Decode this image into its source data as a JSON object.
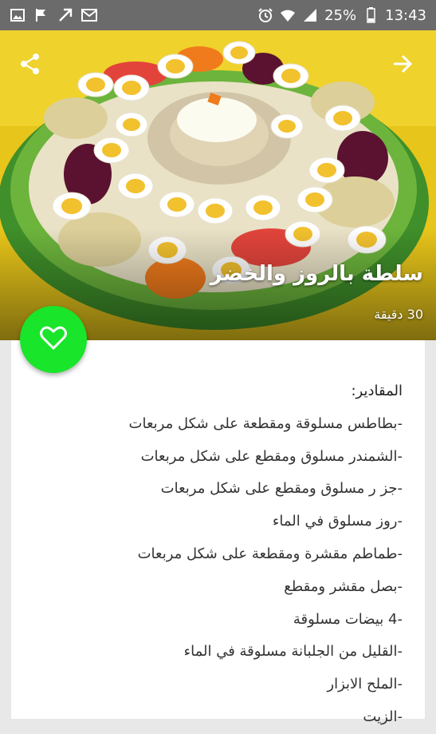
{
  "status_bar": {
    "battery": "25%",
    "time": "13:43",
    "left_icons": [
      "image-icon",
      "flag-icon",
      "arrow-icon",
      "mail-icon"
    ],
    "right_icons": [
      "alarm-icon",
      "wifi-icon",
      "signal-icon",
      "battery-icon"
    ]
  },
  "recipe": {
    "title": "سلطة بالروز والخضر",
    "time": "30 دقيقة"
  },
  "ingredients": {
    "heading": "المقادير:",
    "items": [
      "-بطاطس مسلوقة ومقطعة على شكل مربعات",
      "-الشمندر مسلوق ومقطع على شكل مربعات",
      "-جز ر مسلوق ومقطع على شكل مربعات",
      "-روز مسلوق في الماء",
      "-طماطم مقشرة ومقطعة على شكل مربعات",
      "-بصل مقشر ومقطع",
      "-4 بيضات مسلوقة",
      "-القليل من الجلبانة مسلوقة في الماء",
      "-الملح الابزار",
      "-الزيت"
    ]
  },
  "colors": {
    "status_bar": "#6b6b6b",
    "fab": "#19e52a",
    "page_background": "#e8e8e8",
    "photo_background": "#e7c51a"
  }
}
